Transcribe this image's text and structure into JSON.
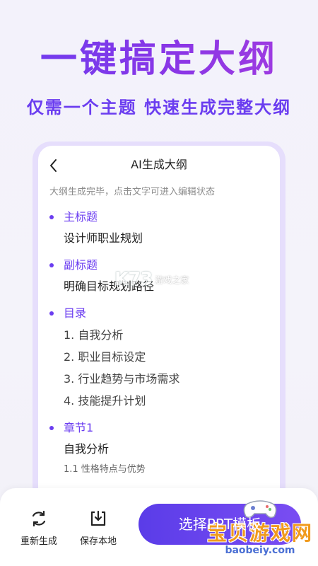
{
  "hero": {
    "title": "一键搞定大纲",
    "subtitle": "仅需一个主题 快速生成完整大纲"
  },
  "screen": {
    "nav_title": "AI生成大纲",
    "back_icon": "chevron-left-icon",
    "hint": "大纲生成完毕，点击文字可进入编辑状态",
    "sections": [
      {
        "label": "主标题",
        "value": "设计师职业规划"
      },
      {
        "label": "副标题",
        "value": "明确目标规划路径"
      },
      {
        "label": "目录",
        "items": [
          "1. 自我分析",
          "2. 职业目标设定",
          "3. 行业趋势与市场需求",
          "4. 技能提升计划"
        ]
      },
      {
        "label": "章节1",
        "value": "自我分析",
        "sub": "1.1 性格特点与优势"
      }
    ]
  },
  "watermark": {
    "logo": "K73",
    "text": "游戏之家"
  },
  "bottom": {
    "regenerate_label": "重新生成",
    "regenerate_icon": "refresh-icon",
    "save_label": "保存本地",
    "save_icon": "download-icon",
    "primary_label": "选择PPT模板"
  },
  "corner_watermark": {
    "title": "宝贝游戏网",
    "url": "baobeiy.com"
  },
  "colors": {
    "accent": "#6b3df0",
    "button": "#5a3ce8",
    "frame": "#e6defc"
  }
}
